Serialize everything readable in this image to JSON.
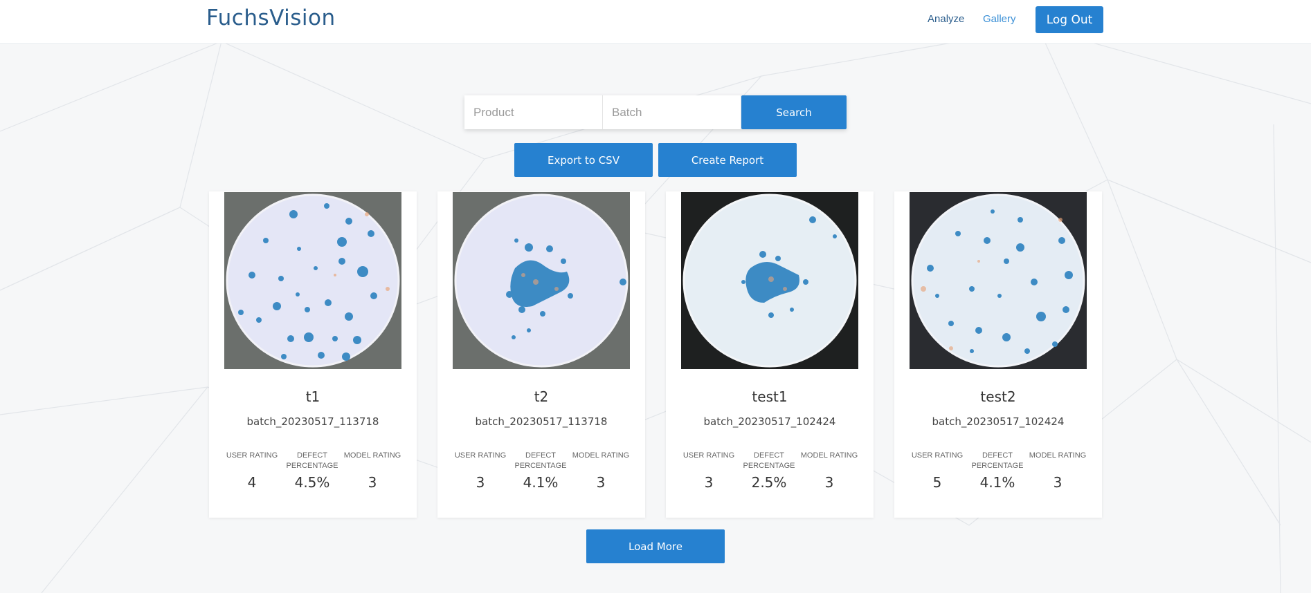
{
  "nav": {
    "brand": "FuchsVision",
    "analyze": "Analyze",
    "gallery": "Gallery",
    "logout": "Log Out"
  },
  "search": {
    "product_placeholder": "Product",
    "batch_placeholder": "Batch",
    "button": "Search"
  },
  "actions": {
    "export": "Export to CSV",
    "report": "Create Report"
  },
  "stat_labels": {
    "user_rating": "USER RATING",
    "defect_percentage": "DEFECT PERCENTAGE",
    "model_rating": "MODEL RATING"
  },
  "cards": [
    {
      "name": "t1",
      "batch": "batch_20230517_113718",
      "user_rating": "4",
      "defect_percentage": "4.5%",
      "model_rating": "3"
    },
    {
      "name": "t2",
      "batch": "batch_20230517_113718",
      "user_rating": "3",
      "defect_percentage": "4.1%",
      "model_rating": "3"
    },
    {
      "name": "test1",
      "batch": "batch_20230517_102424",
      "user_rating": "3",
      "defect_percentage": "2.5%",
      "model_rating": "3"
    },
    {
      "name": "test2",
      "batch": "batch_20230517_102424",
      "user_rating": "5",
      "defect_percentage": "4.1%",
      "model_rating": "3"
    }
  ],
  "load_more": "Load More",
  "colors": {
    "primary": "#2681d0",
    "brand": "#2a5d8c",
    "defect_blob": "#3d8bc4",
    "dish": "#e6e9f7"
  }
}
